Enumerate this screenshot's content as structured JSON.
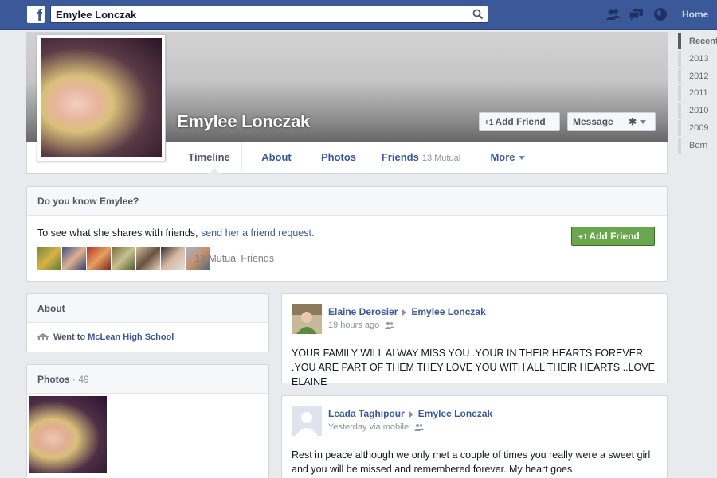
{
  "topbar": {
    "logo_letter": "f",
    "search_value": "Emylee Lonczak",
    "home_label": "Home",
    "brand_color": "#3b5998"
  },
  "profile": {
    "name": "Emylee Lonczak",
    "add_friend_label": "Add Friend",
    "message_label": "Message",
    "plus_glyph": "+1",
    "gear_glyph": "✱"
  },
  "tabs": [
    {
      "label": "Timeline",
      "sub": ""
    },
    {
      "label": "About",
      "sub": ""
    },
    {
      "label": "Photos",
      "sub": ""
    },
    {
      "label": "Friends",
      "sub": "13 Mutual"
    },
    {
      "label": "More",
      "sub": ""
    }
  ],
  "years": [
    "Recent",
    "2013",
    "2012",
    "2011",
    "2010",
    "2009",
    "Born"
  ],
  "know": {
    "title": "Do you know Emylee?",
    "text": "To see what she shares with friends,",
    "link": "send her a friend request.",
    "button_label": "Add Friend",
    "mutual_label": "13 Mutual Friends",
    "button_color": "#69a74e"
  },
  "about": {
    "title": "About",
    "went_to": "Went to",
    "school": "McLean High School"
  },
  "photos": {
    "title": "Photos",
    "count": "· 49"
  },
  "posts": [
    {
      "author": "Elaine Derosier",
      "target": "Emylee Lonczak",
      "time": "19 hours ago",
      "body": "YOUR FAMILY WILL ALWAY MISS YOU .YOUR IN THEIR HEARTS FOREVER .YOU ARE PART OF THEM THEY LOVE YOU WITH ALL THEIR HEARTS ..LOVE ELAINE"
    },
    {
      "author": "Leada Taghipour",
      "target": "Emylee Lonczak",
      "time": "Yesterday via mobile",
      "body": "Rest in peace although we only met a couple of times you really were a sweet girl and you will be missed and remembered forever. My heart goes"
    }
  ]
}
